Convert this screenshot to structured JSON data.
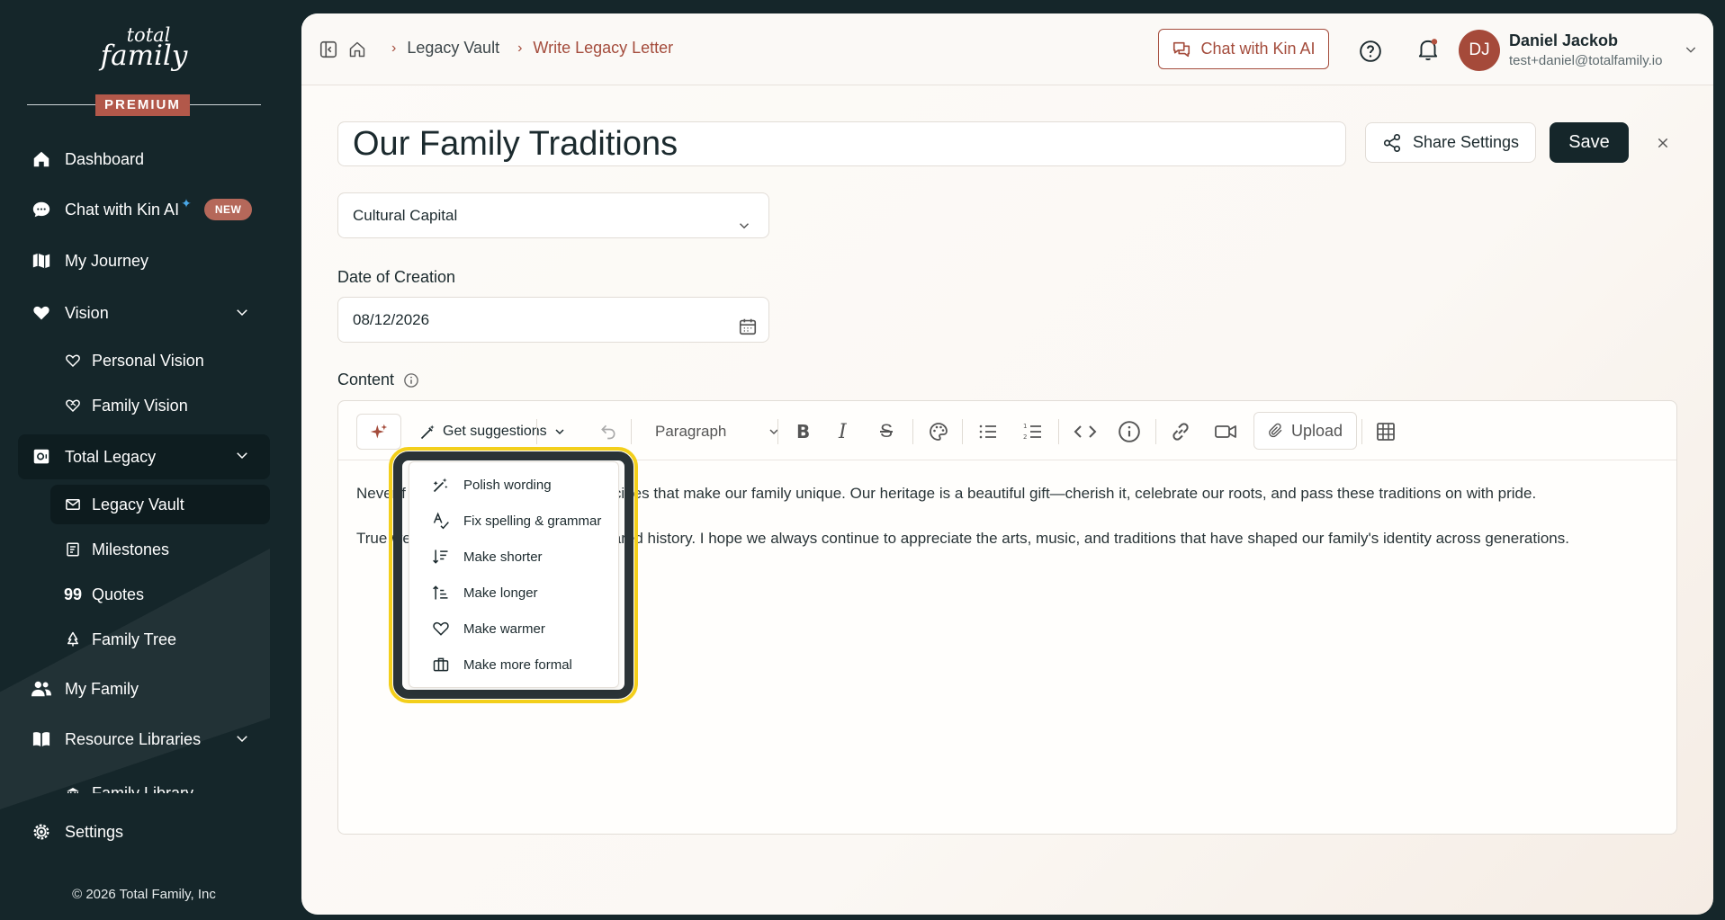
{
  "brand": {
    "logo_line1": "total",
    "logo_line2": "family",
    "tier": "PREMIUM"
  },
  "sidebar": {
    "items": [
      {
        "label": "Dashboard",
        "icon": "home-icon"
      },
      {
        "label": "Chat with Kin AI",
        "icon": "chat-bubble-icon",
        "badge": "NEW"
      },
      {
        "label": "My Journey",
        "icon": "map-icon"
      },
      {
        "label": "Vision",
        "icon": "heart-icon",
        "expanded": true
      },
      {
        "label": "Personal Vision",
        "icon": "heart-outline-icon"
      },
      {
        "label": "Family Vision",
        "icon": "heart-handshake-icon"
      },
      {
        "label": "Total Legacy",
        "icon": "safe-icon",
        "expanded": true
      },
      {
        "label": "Legacy Vault",
        "icon": "mail-icon",
        "active": true
      },
      {
        "label": "Milestones",
        "icon": "milestone-icon"
      },
      {
        "label": "Quotes",
        "icon": "quote-icon"
      },
      {
        "label": "Family Tree",
        "icon": "tree-icon"
      },
      {
        "label": "My Family",
        "icon": "users-icon"
      },
      {
        "label": "Resource Libraries",
        "icon": "book-icon",
        "expanded": true
      },
      {
        "label": "Family Library",
        "icon": "library-icon"
      }
    ],
    "settings": "Settings",
    "footer": "© 2026 Total Family, Inc"
  },
  "header": {
    "breadcrumb": [
      "Legacy Vault",
      "Write Legacy Letter"
    ],
    "chat_button": "Chat with Kin AI",
    "user": {
      "initials": "DJ",
      "name": "Daniel Jackob",
      "email": "test+daniel@totalfamily.io"
    }
  },
  "letter": {
    "title": "Our Family Traditions",
    "share_button": "Share Settings",
    "save_button": "Save",
    "category": "Cultural Capital",
    "date_label": "Date of Creation",
    "date_value": "08/12/2026",
    "content_label": "Content"
  },
  "toolbar": {
    "suggestions": "Get suggestions",
    "block_type": "Paragraph",
    "upload": "Upload"
  },
  "content": {
    "paragraphs": [
      "Never forget the stories and recipes that make our family unique. Our heritage is a beautiful gift—cherish it, celebrate our roots, and pass these traditions on with pride.",
      "True wealth is found in our shared history. I hope we always continue to appreciate the arts, music, and traditions that have shaped our family's identity across generations."
    ],
    "visible_prefixes": [
      "Never f",
      "True we"
    ],
    "visible_suffixes": [
      "recipes that make our family unique. Our heritage is a beautiful gift—cherish it, celebrate our roots, and pass these traditions on with pride.",
      "ared history. I hope we always continue to appreciate the arts, music, and traditions that have shaped our family's identity across generations."
    ]
  },
  "suggestions_menu": [
    {
      "label": "Polish wording",
      "icon": "wand-icon"
    },
    {
      "label": "Fix spelling & grammar",
      "icon": "spell-check-icon"
    },
    {
      "label": "Make shorter",
      "icon": "shorten-icon"
    },
    {
      "label": "Make longer",
      "icon": "lengthen-icon"
    },
    {
      "label": "Make warmer",
      "icon": "heart-outline-icon"
    },
    {
      "label": "Make more formal",
      "icon": "briefcase-icon"
    }
  ],
  "colors": {
    "sidebar_bg": "#15262a",
    "accent": "#a44c3c",
    "highlight": "#f3cf1b"
  }
}
